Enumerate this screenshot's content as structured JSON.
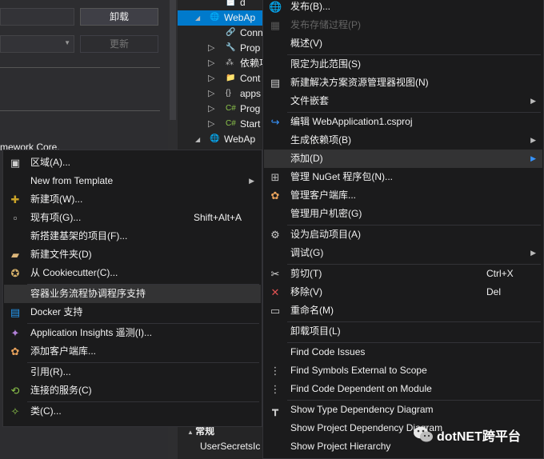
{
  "background": {
    "buttons": {
      "uninstall": "卸载",
      "update": "更新"
    },
    "framework_text": "mework Core.",
    "tree": [
      {
        "label": "d",
        "indent": 1
      },
      {
        "label": "WebAp",
        "indent": 0,
        "selected": true
      },
      {
        "label": "Conn",
        "indent": 1
      },
      {
        "label": "Prop",
        "indent": 1
      },
      {
        "label": "依赖项",
        "indent": 1
      },
      {
        "label": "Cont",
        "indent": 1
      },
      {
        "label": "apps",
        "indent": 1
      },
      {
        "label": "Prog",
        "indent": 1
      },
      {
        "label": "Start",
        "indent": 1
      },
      {
        "label": "WebAp",
        "indent": 0
      }
    ],
    "props": {
      "section": "常规",
      "item": "UserSecretsIc"
    }
  },
  "right_menu": {
    "items": [
      {
        "label": "发布(B)...",
        "icon": "publish-icon",
        "dis": false
      },
      {
        "label": "发布存储过程(P)",
        "icon": "db-icon",
        "dis": true
      },
      {
        "label": "概述(V)"
      },
      {
        "sep": true
      },
      {
        "label": "限定为此范围(S)"
      },
      {
        "label": "新建解决方案资源管理器视图(N)",
        "icon": "new-view-icon"
      },
      {
        "label": "文件嵌套",
        "submenu": true
      },
      {
        "sep": true
      },
      {
        "label": "编辑 WebApplication1.csproj",
        "icon": "edit-icon"
      },
      {
        "label": "生成依赖项(B)",
        "submenu": true
      },
      {
        "label": "添加(D)",
        "submenu": true,
        "highlight": true
      },
      {
        "label": "管理 NuGet 程序包(N)...",
        "icon": "nuget-icon"
      },
      {
        "label": "管理客户端库...",
        "icon": "client-lib-icon"
      },
      {
        "label": "管理用户机密(G)"
      },
      {
        "sep": true
      },
      {
        "label": "设为启动项目(A)",
        "icon": "gear-icon"
      },
      {
        "label": "调试(G)",
        "submenu": true
      },
      {
        "sep": true
      },
      {
        "label": "剪切(T)",
        "icon": "cut-icon",
        "shortcut": "Ctrl+X"
      },
      {
        "label": "移除(V)",
        "icon": "remove-icon",
        "shortcut": "Del"
      },
      {
        "label": "重命名(M)",
        "icon": "rename-icon"
      },
      {
        "sep": true
      },
      {
        "label": "卸载项目(L)"
      },
      {
        "sep": true
      },
      {
        "label": "Find Code Issues"
      },
      {
        "label": "Find Symbols External to Scope",
        "icon": "symbols-icon"
      },
      {
        "label": "Find Code Dependent on Module",
        "icon": "dependent-icon"
      },
      {
        "sep": true
      },
      {
        "label": "Show Type Dependency Diagram",
        "icon": "diagram-icon"
      },
      {
        "label": "Show Project Dependency Diagram"
      },
      {
        "label": "Show Project Hierarchy"
      }
    ]
  },
  "add_menu": {
    "items": [
      {
        "label": "区域(A)...",
        "icon": "area-icon"
      },
      {
        "label": "New from Template",
        "submenu": true
      },
      {
        "label": "新建项(W)...",
        "icon": "new-item-icon"
      },
      {
        "label": "现有项(G)...",
        "icon": "existing-item-icon",
        "shortcut": "Shift+Alt+A"
      },
      {
        "label": "新搭建基架的项目(F)..."
      },
      {
        "label": "新建文件夹(D)",
        "icon": "new-folder-icon"
      },
      {
        "label": "从 Cookiecutter(C)...",
        "icon": "cookiecutter-icon"
      },
      {
        "sep": true
      },
      {
        "label": "容器业务流程协调程序支持",
        "highlight": true
      },
      {
        "label": "Docker 支持",
        "icon": "docker-icon"
      },
      {
        "sep": true
      },
      {
        "label": "Application Insights 遥测(I)...",
        "icon": "insights-icon"
      },
      {
        "label": "添加客户端库...",
        "icon": "client-lib-icon"
      },
      {
        "sep": true
      },
      {
        "label": "引用(R)..."
      },
      {
        "label": "连接的服务(C)",
        "icon": "connected-service-icon"
      },
      {
        "sep": true
      },
      {
        "label": "类(C)...",
        "icon": "class-icon"
      }
    ]
  },
  "watermark": {
    "text": "dotNET跨平台"
  },
  "colors": {
    "accent": "#007acc",
    "menu_bg": "#1b1b1c",
    "highlight": "#333334"
  }
}
